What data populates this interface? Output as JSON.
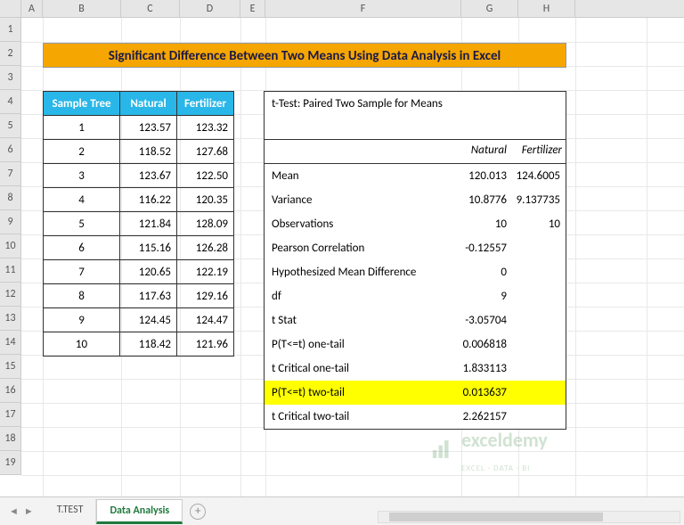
{
  "columns": [
    "A",
    "B",
    "C",
    "D",
    "E",
    "F",
    "G",
    "H"
  ],
  "rows": [
    "1",
    "2",
    "3",
    "4",
    "5",
    "6",
    "7",
    "8",
    "9",
    "10",
    "11",
    "12",
    "13",
    "14",
    "15",
    "16",
    "17",
    "18",
    "19"
  ],
  "banner_title": "Significant Difference Between Two Means Using Data Analysis in Excel",
  "table": {
    "headers": [
      "Sample Tree",
      "Natural",
      "Fertilizer"
    ],
    "rows": [
      [
        "1",
        "123.57",
        "123.32"
      ],
      [
        "2",
        "118.52",
        "127.68"
      ],
      [
        "3",
        "123.67",
        "122.50"
      ],
      [
        "4",
        "116.22",
        "120.35"
      ],
      [
        "5",
        "121.84",
        "128.09"
      ],
      [
        "6",
        "115.16",
        "126.28"
      ],
      [
        "7",
        "120.65",
        "122.19"
      ],
      [
        "8",
        "117.63",
        "129.16"
      ],
      [
        "9",
        "124.45",
        "124.47"
      ],
      [
        "10",
        "118.42",
        "121.96"
      ]
    ]
  },
  "results": {
    "title": "t-Test: Paired Two Sample for Means",
    "col1": "Natural",
    "col2": "Fertilizer",
    "rows": [
      {
        "lbl": "Mean",
        "v1": "120.013",
        "v2": "124.6005",
        "hlt": false
      },
      {
        "lbl": "Variance",
        "v1": "10.8776",
        "v2": "9.137735",
        "hlt": false
      },
      {
        "lbl": "Observations",
        "v1": "10",
        "v2": "10",
        "hlt": false
      },
      {
        "lbl": "Pearson Correlation",
        "v1": "-0.12557",
        "v2": "",
        "hlt": false
      },
      {
        "lbl": "Hypothesized Mean Difference",
        "v1": "0",
        "v2": "",
        "hlt": false
      },
      {
        "lbl": "df",
        "v1": "9",
        "v2": "",
        "hlt": false
      },
      {
        "lbl": "t Stat",
        "v1": "-3.05704",
        "v2": "",
        "hlt": false
      },
      {
        "lbl": "P(T<=t) one-tail",
        "v1": "0.006818",
        "v2": "",
        "hlt": false
      },
      {
        "lbl": "t Critical one-tail",
        "v1": "1.833113",
        "v2": "",
        "hlt": false
      },
      {
        "lbl": "P(T<=t) two-tail",
        "v1": "0.013637",
        "v2": "",
        "hlt": true
      },
      {
        "lbl": "t Critical two-tail",
        "v1": "2.262157",
        "v2": "",
        "hlt": false
      }
    ]
  },
  "watermark": {
    "brand": "exceldemy",
    "tag": "EXCEL · DATA · BI"
  },
  "tabs": {
    "items": [
      "T.TEST",
      "Data Analysis"
    ],
    "active": 1
  },
  "chart_data": {
    "type": "table",
    "title": "t-Test: Paired Two Sample for Means",
    "series": [
      {
        "name": "Natural",
        "values": [
          123.57,
          118.52,
          123.67,
          116.22,
          121.84,
          115.16,
          120.65,
          117.63,
          124.45,
          118.42
        ]
      },
      {
        "name": "Fertilizer",
        "values": [
          123.32,
          127.68,
          122.5,
          120.35,
          128.09,
          126.28,
          122.19,
          129.16,
          124.47,
          121.96
        ]
      }
    ],
    "stats": {
      "Mean": [
        120.013,
        124.6005
      ],
      "Variance": [
        10.8776,
        9.137735
      ],
      "Observations": [
        10,
        10
      ],
      "Pearson Correlation": -0.12557,
      "Hypothesized Mean Difference": 0,
      "df": 9,
      "t Stat": -3.05704,
      "P(T<=t) one-tail": 0.006818,
      "t Critical one-tail": 1.833113,
      "P(T<=t) two-tail": 0.013637,
      "t Critical two-tail": 2.262157
    }
  }
}
